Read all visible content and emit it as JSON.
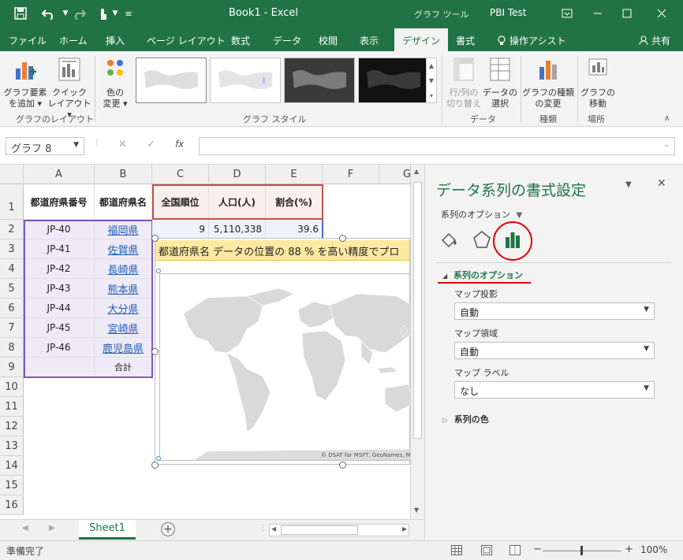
{
  "titlebar": {
    "title": "Book1  -  Excel",
    "tools_label": "グラフ ツール",
    "user": "PBI Test",
    "share_label": "共有"
  },
  "tabs": [
    {
      "label": "ファイル"
    },
    {
      "label": "ホーム"
    },
    {
      "label": "挿入"
    },
    {
      "label": "ページ レイアウト"
    },
    {
      "label": "数式"
    },
    {
      "label": "データ"
    },
    {
      "label": "校閲"
    },
    {
      "label": "表示"
    },
    {
      "label": "デザイン"
    },
    {
      "label": "書式"
    },
    {
      "label": "操作アシスト"
    }
  ],
  "ribbon": {
    "add_element": [
      "グラフ要素",
      "を追加"
    ],
    "quick_layout": [
      "クイック",
      "レイアウト"
    ],
    "change_color": [
      "色の",
      "変更"
    ],
    "switch_rowcol": [
      "行/列の",
      "切り替え"
    ],
    "select_data": [
      "データの",
      "選択"
    ],
    "change_type": [
      "グラフの種類",
      "の変更"
    ],
    "move_chart": [
      "グラフの",
      "移動"
    ],
    "groups": {
      "layout": "グラフのレイアウト",
      "styles": "グラフ スタイル",
      "data": "データ",
      "type": "種類",
      "location": "場所"
    }
  },
  "formula_bar": {
    "name_box": "グラフ 8",
    "fx": "fx"
  },
  "grid": {
    "columns": [
      "A",
      "B",
      "C",
      "D",
      "E",
      "F",
      "G"
    ],
    "rows": [
      "1",
      "2",
      "3",
      "4",
      "5",
      "6",
      "7",
      "8",
      "9",
      "10",
      "11",
      "12",
      "13",
      "14",
      "15",
      "16"
    ],
    "headers": {
      "a": "都道府県番号",
      "b": "都道府県名",
      "c": "全国順位",
      "d": "人口(人)",
      "e": "割合(%)"
    },
    "data_rows": [
      {
        "code": "JP-40",
        "name": "福岡県"
      },
      {
        "code": "JP-41",
        "name": "佐賀県"
      },
      {
        "code": "JP-42",
        "name": "長崎県"
      },
      {
        "code": "JP-43",
        "name": "熊本県"
      },
      {
        "code": "JP-44",
        "name": "大分県"
      },
      {
        "code": "JP-45",
        "name": "宮崎県"
      },
      {
        "code": "JP-46",
        "name": "鹿児島県"
      }
    ],
    "row2": {
      "rank": "9",
      "population": "5,110,338",
      "ratio": "39.6"
    },
    "total_label": "合計"
  },
  "chart": {
    "banner": "都道府県名 データの位置の 88 % を高い精度でプロ",
    "credit": "© DSAT for MSFT, GeoNames, Micr",
    "land_color": "#d9d9d9",
    "banner_color": "#fde9a0"
  },
  "sheet_tabs": {
    "active": "Sheet1"
  },
  "pane": {
    "title": "データ系列の書式設定",
    "options_label": "系列のオプション",
    "section_title": "系列のオプション",
    "projection_label": "マップ投影",
    "projection_value": "自動",
    "area_label": "マップ領域",
    "area_value": "自動",
    "labels_label": "マップ ラベル",
    "labels_value": "なし",
    "color_section": "系列の色",
    "accent": "#217346",
    "highlight": "#e00000"
  },
  "status": {
    "ready": "準備完了",
    "zoom": "100%"
  }
}
